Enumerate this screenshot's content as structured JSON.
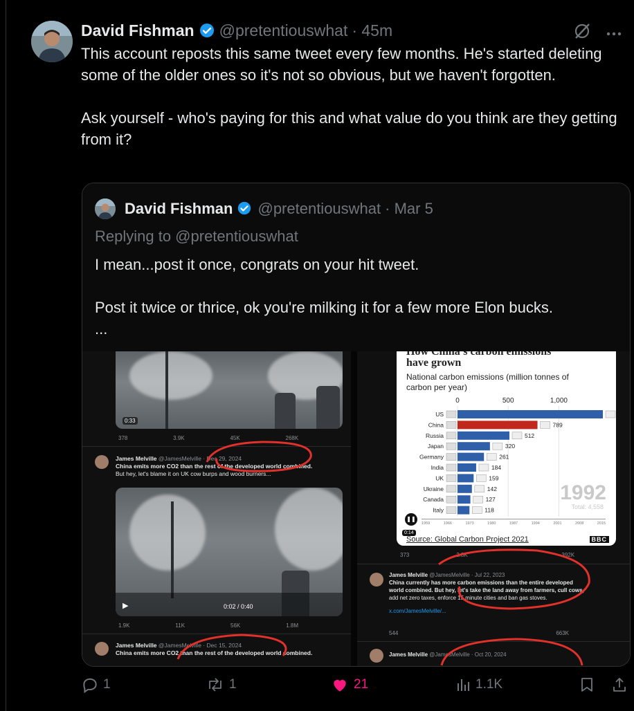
{
  "tweet": {
    "author_name": "David Fishman",
    "handle": "@pretentiouswhat",
    "time": "· 45m",
    "text": "This account reposts this same tweet every few months. He's started deleting some of the older ones so it's not so obvious, but we haven't forgotten.\n\nAsk yourself - who's paying for this and what value do you think are they getting from it?"
  },
  "quote": {
    "author_name": "David Fishman",
    "handle": "@pretentiouswhat",
    "time": "· Mar 5",
    "replying_to": "Replying to @pretentiouswhat",
    "text": "I mean...post it once, congrats on your hit tweet.\n\nPost it twice or thrice, ok you're milking it for a few more Elon bucks.\n..."
  },
  "media_left": {
    "video1_duration": "0:33",
    "video1_stats": [
      "378",
      "3.9K",
      "45K",
      "268K"
    ],
    "post1_author": "James Melville",
    "post1_meta": "@JamesMelville · Dec 29, 2024",
    "post1_text_1": "China emits more CO2 than the rest of the developed world combined.",
    "post1_text_2": "But hey, let's blame it on UK cow burps and wood burners...",
    "video2_time": "0:02 / 0:40",
    "video2_stats": [
      "1.9K",
      "11K",
      "56K",
      "1.8M"
    ],
    "post2_author": "James Melville",
    "post2_meta": "@JamesMelville · Dec 15, 2024",
    "post2_text": "China emits more CO2 than the rest of the developed world combined."
  },
  "media_right": {
    "chart_title_partial": "How China's carbon emissions",
    "chart_title": "have grown",
    "chart_subtitle_1": "National carbon emissions (million tonnes of",
    "chart_subtitle_2": "carbon per year)",
    "year_label": "1992",
    "total_label": "Total: 4,558",
    "timeline_years": [
      "1959",
      "1966",
      "1973",
      "1980",
      "1987",
      "1994",
      "2001",
      "2008",
      "2015"
    ],
    "video_time": "0:14",
    "source": "Source: Global Carbon Project 2021",
    "source_logo": "BBC",
    "stats": [
      "373",
      "2.8K",
      "",
      "392K"
    ],
    "post1_author": "James Melville",
    "post1_meta": "@JamesMelville · Jul 22, 2023",
    "post1_text_1": "China currently has more carbon emissions than the entire developed",
    "post1_text_2": "world combined. But hey, let's take the land away from farmers, cull cows,",
    "post1_text_3": "add net zero taxes, enforce 15 minute cities and ban gas stoves.",
    "post1_link": "x.com/JamesMelville/...",
    "post1_stats": [
      "544",
      "",
      "",
      "663K"
    ],
    "post2_author": "James Melville",
    "post2_meta": "@JamesMelville · Oct 20, 2024"
  },
  "chart_data": {
    "type": "bar",
    "title": "have grown",
    "categories": [
      "US",
      "China",
      "Russia",
      "Japan",
      "Germany",
      "India",
      "UK",
      "Ukraine",
      "Canada",
      "Italy"
    ],
    "values": [
      1434,
      789,
      512,
      320,
      261,
      184,
      159,
      142,
      127,
      118
    ],
    "xlim": [
      0,
      1434
    ],
    "xticks": [
      "0",
      "500",
      "1,000"
    ],
    "colors": {
      "US": "#2f5fa8",
      "China": "#c0281e",
      "default": "#2f5fa8"
    }
  },
  "actions": {
    "replies": "1",
    "reposts": "1",
    "likes": "21",
    "views": "1.1K"
  },
  "colors": {
    "like": "#f91880",
    "verified": "#1d9bf0",
    "annotation_red": "#e0312b"
  }
}
